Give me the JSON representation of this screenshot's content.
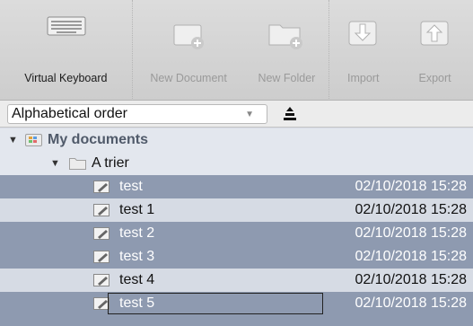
{
  "toolbar": {
    "virtual_keyboard": "Virtual Keyboard",
    "new_document": "New Document",
    "new_folder": "New Folder",
    "import": "Import",
    "export": "Export"
  },
  "sort": {
    "selected": "Alphabetical order"
  },
  "tree": {
    "root": "My documents",
    "folder": "A trier",
    "items": [
      {
        "name": "test",
        "date": "02/10/2018 15:28"
      },
      {
        "name": "test 1",
        "date": "02/10/2018 15:28"
      },
      {
        "name": "test 2",
        "date": "02/10/2018 15:28"
      },
      {
        "name": "test 3",
        "date": "02/10/2018 15:28"
      },
      {
        "name": "test 4",
        "date": "02/10/2018 15:28"
      },
      {
        "name": "test 5",
        "date": "02/10/2018 15:28"
      }
    ]
  },
  "colors": {
    "selected_row": "#8e9ab0",
    "plain_row": "#d6dbe4",
    "root_icon": "#e0a23a"
  }
}
